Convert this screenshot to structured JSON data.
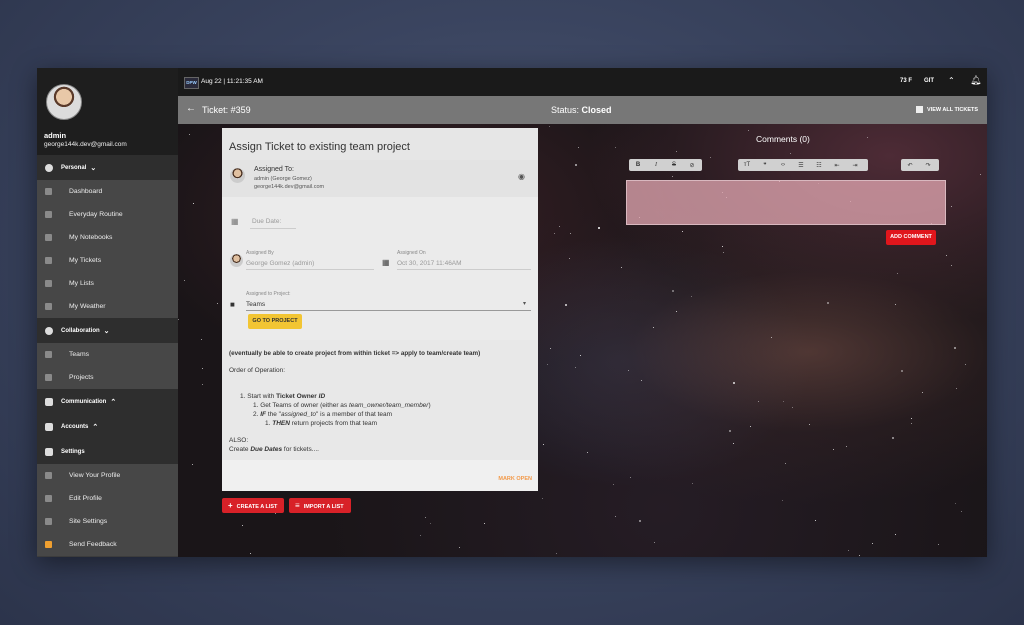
{
  "user": {
    "name": "admin",
    "email": "george144k.dev@gmail.com"
  },
  "sidebar": {
    "sections": [
      {
        "label": "Personal"
      },
      {
        "label": "Collaboration"
      },
      {
        "label": "Communication"
      },
      {
        "label": "Accounts"
      },
      {
        "label": "Settings"
      }
    ],
    "personal_items": [
      "Dashboard",
      "Everyday Routine",
      "My Notebooks",
      "My Tickets",
      "My Lists",
      "My Weather"
    ],
    "collab_items": [
      "Teams",
      "Projects"
    ],
    "settings_items": [
      "View Your Profile",
      "Edit Profile",
      "Site Settings",
      "Send Feedback"
    ]
  },
  "topbar": {
    "logo": "DPW",
    "date": "Aug 22",
    "time": "11:21:35 AM",
    "temp": "73 F",
    "git": "GIT"
  },
  "ticketbar": {
    "ticket": "Ticket: #359",
    "status_label": "Status:",
    "status_value": "Closed",
    "view_all": "VIEW ALL TICKETS"
  },
  "ticket": {
    "title": "Assign Ticket to existing team project",
    "assigned_to_label": "Assigned To:",
    "assigned_to_name": "admin (George Gomez)",
    "assigned_to_email": "george144k.dev@gmail.com",
    "due_date_placeholder": "Due Date:",
    "assigned_by_label": "Assigned By",
    "assigned_by_value": "George Gomez (admin)",
    "assigned_on_label": "Assigned On",
    "assigned_on_value": "Oct 30, 2017 11:46AM",
    "project_label": "Assigned to Project:",
    "project_value": "Teams",
    "go_to_project": "GO TO PROJECT",
    "notes": {
      "headline": "(eventually be able to create project from within ticket => apply to team/create team)",
      "order": "Order of Operation:",
      "step1_a": "1. Start with ",
      "step1_b": "Ticket Owner ",
      "step1_c": "ID",
      "step2_a": "1. Get Teams of owner (either as ",
      "step2_b": "team_owner/team_member",
      "step2_c": ")",
      "step3_a": "2. ",
      "step3_b": "IF",
      "step3_c": " the \"",
      "step3_d": "assigned_to",
      "step3_e": "\" is a member of that team",
      "step4_a": "1. ",
      "step4_b": "THEN",
      "step4_c": " return projects from that team",
      "also": "ALSO:",
      "create_a": "Create ",
      "create_b": "Due Dates",
      "create_c": " for tickets...."
    },
    "mark_open": "MARK OPEN"
  },
  "actions": {
    "create_list": "CREATE A LIST",
    "import_list": "IMPORT A LIST"
  },
  "comments": {
    "title": "Comments (0)",
    "add": "ADD COMMENT"
  },
  "colors": {
    "accent_red": "#d82128",
    "accent_yellow": "#f2c533",
    "mark_open": "#f39a4a"
  },
  "icons": [
    "back-arrow-icon",
    "eye-icon",
    "calendar-icon",
    "briefcase-icon",
    "bell-icon",
    "chevron-up-icon",
    "list-icon",
    "plus-icon",
    "undo-icon",
    "redo-icon"
  ]
}
